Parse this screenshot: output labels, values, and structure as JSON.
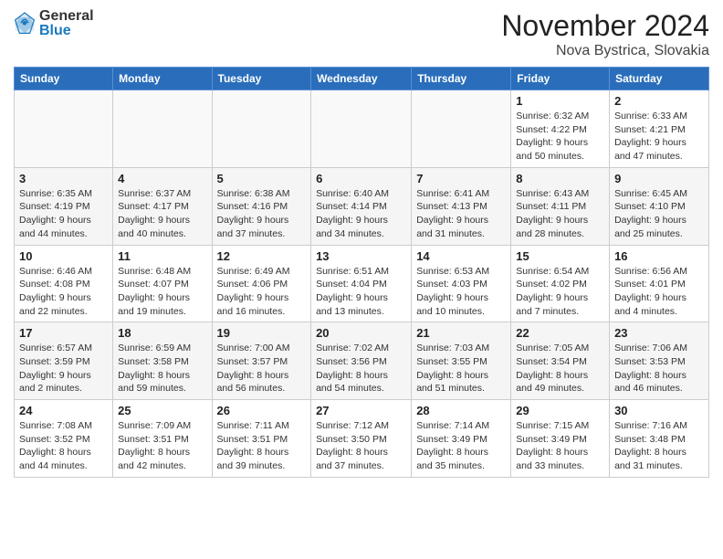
{
  "logo": {
    "general": "General",
    "blue": "Blue"
  },
  "title": "November 2024",
  "subtitle": "Nova Bystrica, Slovakia",
  "weekdays": [
    "Sunday",
    "Monday",
    "Tuesday",
    "Wednesday",
    "Thursday",
    "Friday",
    "Saturday"
  ],
  "weeks": [
    [
      {
        "day": "",
        "info": ""
      },
      {
        "day": "",
        "info": ""
      },
      {
        "day": "",
        "info": ""
      },
      {
        "day": "",
        "info": ""
      },
      {
        "day": "",
        "info": ""
      },
      {
        "day": "1",
        "info": "Sunrise: 6:32 AM\nSunset: 4:22 PM\nDaylight: 9 hours and 50 minutes."
      },
      {
        "day": "2",
        "info": "Sunrise: 6:33 AM\nSunset: 4:21 PM\nDaylight: 9 hours and 47 minutes."
      }
    ],
    [
      {
        "day": "3",
        "info": "Sunrise: 6:35 AM\nSunset: 4:19 PM\nDaylight: 9 hours and 44 minutes."
      },
      {
        "day": "4",
        "info": "Sunrise: 6:37 AM\nSunset: 4:17 PM\nDaylight: 9 hours and 40 minutes."
      },
      {
        "day": "5",
        "info": "Sunrise: 6:38 AM\nSunset: 4:16 PM\nDaylight: 9 hours and 37 minutes."
      },
      {
        "day": "6",
        "info": "Sunrise: 6:40 AM\nSunset: 4:14 PM\nDaylight: 9 hours and 34 minutes."
      },
      {
        "day": "7",
        "info": "Sunrise: 6:41 AM\nSunset: 4:13 PM\nDaylight: 9 hours and 31 minutes."
      },
      {
        "day": "8",
        "info": "Sunrise: 6:43 AM\nSunset: 4:11 PM\nDaylight: 9 hours and 28 minutes."
      },
      {
        "day": "9",
        "info": "Sunrise: 6:45 AM\nSunset: 4:10 PM\nDaylight: 9 hours and 25 minutes."
      }
    ],
    [
      {
        "day": "10",
        "info": "Sunrise: 6:46 AM\nSunset: 4:08 PM\nDaylight: 9 hours and 22 minutes."
      },
      {
        "day": "11",
        "info": "Sunrise: 6:48 AM\nSunset: 4:07 PM\nDaylight: 9 hours and 19 minutes."
      },
      {
        "day": "12",
        "info": "Sunrise: 6:49 AM\nSunset: 4:06 PM\nDaylight: 9 hours and 16 minutes."
      },
      {
        "day": "13",
        "info": "Sunrise: 6:51 AM\nSunset: 4:04 PM\nDaylight: 9 hours and 13 minutes."
      },
      {
        "day": "14",
        "info": "Sunrise: 6:53 AM\nSunset: 4:03 PM\nDaylight: 9 hours and 10 minutes."
      },
      {
        "day": "15",
        "info": "Sunrise: 6:54 AM\nSunset: 4:02 PM\nDaylight: 9 hours and 7 minutes."
      },
      {
        "day": "16",
        "info": "Sunrise: 6:56 AM\nSunset: 4:01 PM\nDaylight: 9 hours and 4 minutes."
      }
    ],
    [
      {
        "day": "17",
        "info": "Sunrise: 6:57 AM\nSunset: 3:59 PM\nDaylight: 9 hours and 2 minutes."
      },
      {
        "day": "18",
        "info": "Sunrise: 6:59 AM\nSunset: 3:58 PM\nDaylight: 8 hours and 59 minutes."
      },
      {
        "day": "19",
        "info": "Sunrise: 7:00 AM\nSunset: 3:57 PM\nDaylight: 8 hours and 56 minutes."
      },
      {
        "day": "20",
        "info": "Sunrise: 7:02 AM\nSunset: 3:56 PM\nDaylight: 8 hours and 54 minutes."
      },
      {
        "day": "21",
        "info": "Sunrise: 7:03 AM\nSunset: 3:55 PM\nDaylight: 8 hours and 51 minutes."
      },
      {
        "day": "22",
        "info": "Sunrise: 7:05 AM\nSunset: 3:54 PM\nDaylight: 8 hours and 49 minutes."
      },
      {
        "day": "23",
        "info": "Sunrise: 7:06 AM\nSunset: 3:53 PM\nDaylight: 8 hours and 46 minutes."
      }
    ],
    [
      {
        "day": "24",
        "info": "Sunrise: 7:08 AM\nSunset: 3:52 PM\nDaylight: 8 hours and 44 minutes."
      },
      {
        "day": "25",
        "info": "Sunrise: 7:09 AM\nSunset: 3:51 PM\nDaylight: 8 hours and 42 minutes."
      },
      {
        "day": "26",
        "info": "Sunrise: 7:11 AM\nSunset: 3:51 PM\nDaylight: 8 hours and 39 minutes."
      },
      {
        "day": "27",
        "info": "Sunrise: 7:12 AM\nSunset: 3:50 PM\nDaylight: 8 hours and 37 minutes."
      },
      {
        "day": "28",
        "info": "Sunrise: 7:14 AM\nSunset: 3:49 PM\nDaylight: 8 hours and 35 minutes."
      },
      {
        "day": "29",
        "info": "Sunrise: 7:15 AM\nSunset: 3:49 PM\nDaylight: 8 hours and 33 minutes."
      },
      {
        "day": "30",
        "info": "Sunrise: 7:16 AM\nSunset: 3:48 PM\nDaylight: 8 hours and 31 minutes."
      }
    ]
  ]
}
